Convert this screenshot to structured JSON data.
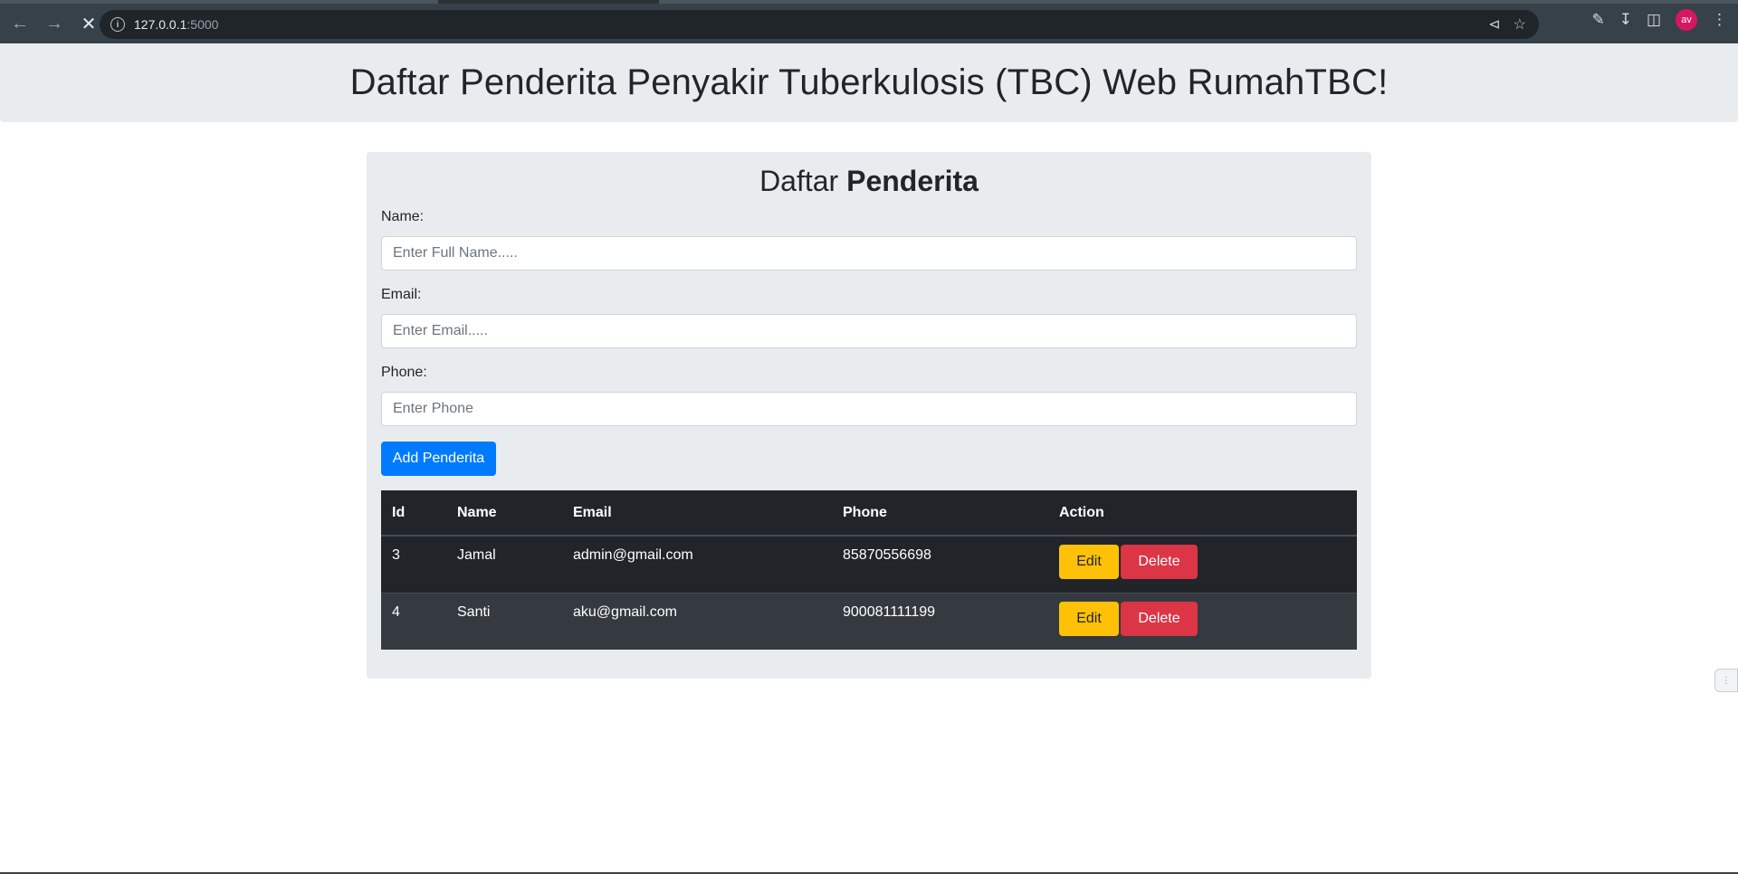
{
  "browser": {
    "url_host": "127.0.0.1",
    "url_port": ":5000",
    "avatar_initials": "av"
  },
  "header": {
    "title": "Daftar Penderita Penyakir Tuberkulosis (TBC) Web RumahTBC!"
  },
  "form": {
    "title_prefix": "Daftar ",
    "title_bold": "Penderita",
    "name_label": "Name:",
    "name_placeholder": "Enter Full Name.....",
    "email_label": "Email:",
    "email_placeholder": "Enter Email.....",
    "phone_label": "Phone:",
    "phone_placeholder": "Enter Phone",
    "submit_label": "Add Penderita"
  },
  "table": {
    "columns": [
      "Id",
      "Name",
      "Email",
      "Phone",
      "Action"
    ],
    "rows": [
      {
        "id": "3",
        "name": "Jamal",
        "email": "admin@gmail.com",
        "phone": "85870556698",
        "edit": "Edit",
        "delete": "Delete"
      },
      {
        "id": "4",
        "name": "Santi",
        "email": "aku@gmail.com",
        "phone": "900081111199",
        "edit": "Edit",
        "delete": "Delete"
      }
    ]
  },
  "colors": {
    "primary": "#007bff",
    "warning": "#ffc107",
    "danger": "#dc3545",
    "table_dark": "#212529"
  }
}
